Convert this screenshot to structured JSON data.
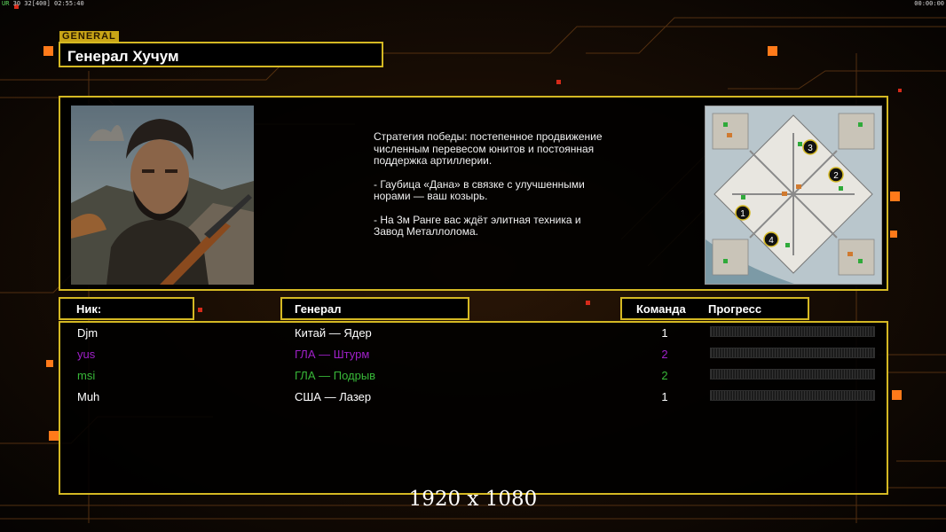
{
  "hud": {
    "left_top_green": "UR",
    "left_top_info": "30 32[400] 02:55:40",
    "right_top": "00:00:00"
  },
  "general_tag": "GENERAL",
  "general_name": "Генерал Хучум",
  "strategy": {
    "p1": "Стратегия победы: постепенное продвижение численным перевесом юнитов и постоянная поддержка артиллерии.",
    "p2": "- Гаубица «Дана» в связке с улучшенными норами — ваш козырь.",
    "p3": "- На 3м Ранге вас ждёт элитная техника и Завод Металлолома."
  },
  "minimap": {
    "start_markers": [
      "1",
      "2",
      "3",
      "4"
    ]
  },
  "headers": {
    "nick": "Ник:",
    "general": "Генерал",
    "team": "Команда",
    "progress": "Прогресс"
  },
  "players": [
    {
      "nick": "Djm",
      "general": "Китай — Ядер",
      "team": "1",
      "color": "#ffffff",
      "progress": 0
    },
    {
      "nick": "yus",
      "general": "ГЛА — Штурм",
      "team": "2",
      "color": "#a020c8",
      "progress": 0
    },
    {
      "nick": "msi",
      "general": "ГЛА — Подрыв",
      "team": "2",
      "color": "#38b838",
      "progress": 0
    },
    {
      "nick": "Muh",
      "general": "США — Лазер",
      "team": "1",
      "color": "#ffffff",
      "progress": 0
    }
  ],
  "resolution_text": "1920 x 1080",
  "colors": {
    "frame": "#d4b823",
    "accent": "#ff7a1a"
  }
}
